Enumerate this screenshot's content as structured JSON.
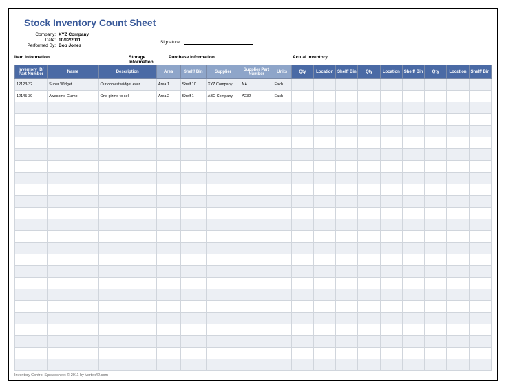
{
  "title": "Stock Inventory Count Sheet",
  "meta": {
    "company_label": "Company:",
    "company": "XYZ Company",
    "date_label": "Date:",
    "date": "10/12/2011",
    "performed_label": "Performed By:",
    "performed": "Bob Jones",
    "signature_label": "Signature:"
  },
  "groups": {
    "item": "Item Information",
    "storage": "Storage Information",
    "purchase": "Purchase Information",
    "actual": "Actual Inventory"
  },
  "headers": {
    "inv": "Inventory ID/ Part Number",
    "name": "Name",
    "desc": "Description",
    "area": "Area",
    "shelf": "Shelf/ Bin",
    "supplier": "Supplier",
    "sp": "Supplier Part Number",
    "units": "Units",
    "qty": "Qty",
    "location": "Location",
    "shelfbin": "Shelf/ Bin"
  },
  "rows": [
    {
      "inv": "12123-32",
      "name": "Super Widget",
      "desc": "Our coolest widget ever",
      "area": "Area 1",
      "shelf": "Shelf 10",
      "supplier": "XYZ Company",
      "sp": "NA",
      "units": "Each"
    },
    {
      "inv": "12145-39",
      "name": "Awesome Gizmo",
      "desc": "One gizmo to sell",
      "area": "Area 2",
      "shelf": "Shelf 1",
      "supplier": "ABC Company",
      "sp": "A232",
      "units": "Each"
    }
  ],
  "empty_rows": 23,
  "footer": "Inventory Control Spreadsheet © 2011 by Vertex42.com"
}
